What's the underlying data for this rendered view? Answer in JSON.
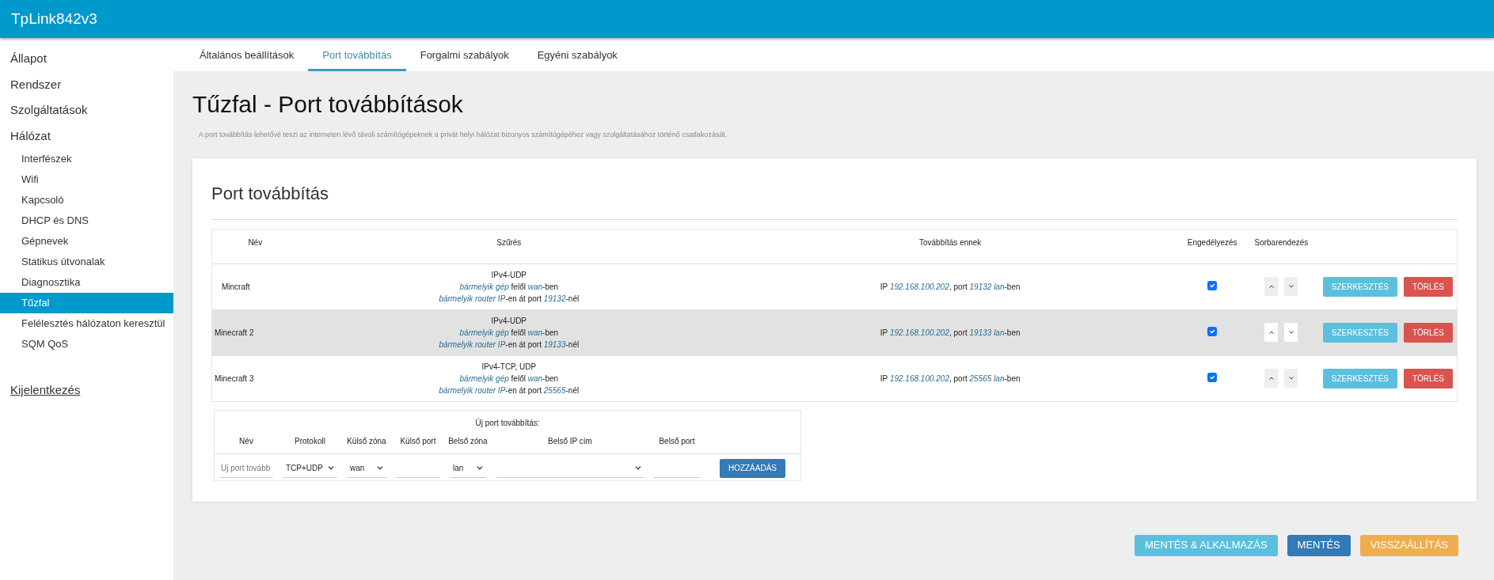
{
  "brand": "TpLink842v3",
  "sidebar": {
    "items": [
      {
        "label": "Állapot",
        "selected": false
      },
      {
        "label": "Rendszer",
        "selected": false
      },
      {
        "label": "Szolgáltatások",
        "selected": false
      },
      {
        "label": "Hálózat",
        "selected": false,
        "children": [
          {
            "label": "Interfészek",
            "selected": false
          },
          {
            "label": "Wifi",
            "selected": false
          },
          {
            "label": "Kapcsoló",
            "selected": false
          },
          {
            "label": "DHCP és DNS",
            "selected": false
          },
          {
            "label": "Gépnevek",
            "selected": false
          },
          {
            "label": "Statikus útvonalak",
            "selected": false
          },
          {
            "label": "Diagnosztika",
            "selected": false
          },
          {
            "label": "Tűzfal",
            "selected": true
          },
          {
            "label": "Felélesztés hálózaton keresztül",
            "selected": false
          },
          {
            "label": "SQM QoS",
            "selected": false
          }
        ]
      }
    ],
    "logout": "Kijelentkezés"
  },
  "tabs": [
    {
      "label": "Általános beállítások",
      "selected": false
    },
    {
      "label": "Port továbbítás",
      "selected": true
    },
    {
      "label": "Forgalmi szabályok",
      "selected": false
    },
    {
      "label": "Egyéni szabályok",
      "selected": false
    }
  ],
  "page_title": "Tűzfal - Port továbbítások",
  "description": "A port továbbítás lehetővé teszi az interneten lévő távoli számítógépeknek a privát helyi hálózat bizonyos számítógépéhez vagy szolgáltatásához történő csatlakozását.",
  "section_title": "Port továbbítás",
  "table": {
    "columns": [
      "Név",
      "Szűrés",
      "Továbbítás ennek",
      "Engedélyezés",
      "Sorbarendezés"
    ],
    "rows": [
      {
        "name": "Mincraft",
        "filter": [
          "IPv4-UDP",
          "*bármelyik gép* felől *wan*-ben",
          "*bármelyik router IP*-en át port *19132*-nél"
        ],
        "target": "IP *192.168.100.202*, port *19132* *lan*-ben",
        "enabled": true,
        "highlighted": false,
        "edit": "SZERKESZTÉS",
        "delete": "TÖRLÉS"
      },
      {
        "name": "Minecraft 2",
        "filter": [
          "IPv4-UDP",
          "*bármelyik gép* felől *wan*-ben",
          "*bármelyik router IP*-en át port *19133*-nél"
        ],
        "target": "IP *192.168.100.202*, port *19133* *lan*-ben",
        "enabled": true,
        "highlighted": true,
        "edit": "SZERKESZTÉS",
        "delete": "TÖRLÉS"
      },
      {
        "name": "Minecraft 3",
        "filter": [
          "IPv4-TCP, UDP",
          "*bármelyik gép* felől *wan*-ben",
          "*bármelyik router IP*-en át port *25565*-nél"
        ],
        "target": "IP *192.168.100.202*, port *25565* *lan*-ben",
        "enabled": true,
        "highlighted": false,
        "edit": "SZERKESZTÉS",
        "delete": "TÖRLÉS"
      }
    ]
  },
  "new_forward": {
    "title": "Új port továbbítás:",
    "columns": [
      "Név",
      "Protokoll",
      "Külső zóna",
      "Külső port",
      "Belső zóna",
      "Belső IP cím",
      "Belső port"
    ],
    "name_placeholder": "Új port tovább",
    "protocol": "TCP+UDP",
    "external_zone": "wan",
    "internal_zone": "lan",
    "add_button": "HOZZÁADÁS"
  },
  "footer_buttons": [
    {
      "label": "MENTÉS & ALKALMAZÁS",
      "kind": "info"
    },
    {
      "label": "MENTÉS",
      "kind": "primary"
    },
    {
      "label": "VISSZAÁLLÍTÁS",
      "kind": "warning"
    }
  ]
}
